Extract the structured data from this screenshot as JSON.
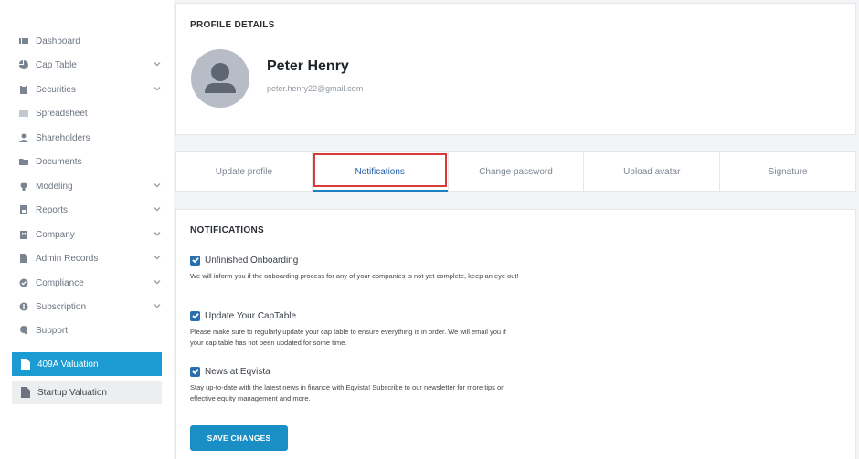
{
  "sidebar": {
    "items": [
      {
        "label": "Dashboard",
        "icon": "dashboard-icon",
        "chevron": false
      },
      {
        "label": "Cap Table",
        "icon": "pie-chart-icon",
        "chevron": true
      },
      {
        "label": "Securities",
        "icon": "clipboard-icon",
        "chevron": true
      },
      {
        "label": "Spreadsheet",
        "icon": "table-icon",
        "chevron": false
      },
      {
        "label": "Shareholders",
        "icon": "user-icon",
        "chevron": false
      },
      {
        "label": "Documents",
        "icon": "folder-icon",
        "chevron": false
      },
      {
        "label": "Modeling",
        "icon": "lightbulb-icon",
        "chevron": true
      },
      {
        "label": "Reports",
        "icon": "report-icon",
        "chevron": true
      },
      {
        "label": "Company",
        "icon": "building-icon",
        "chevron": true
      },
      {
        "label": "Admin Records",
        "icon": "file-icon",
        "chevron": true
      },
      {
        "label": "Compliance",
        "icon": "check-circle-icon",
        "chevron": true
      },
      {
        "label": "Subscription",
        "icon": "dollar-icon",
        "chevron": true
      },
      {
        "label": "Support",
        "icon": "support-icon",
        "chevron": false
      }
    ],
    "valuation_active": "409A Valuation",
    "valuation_inactive": "Startup Valuation"
  },
  "profile": {
    "section_title": "PROFILE DETAILS",
    "name": "Peter Henry",
    "email": "peter.henry22@gmail.com"
  },
  "tabs": [
    {
      "label": "Update profile",
      "active": false
    },
    {
      "label": "Notifications",
      "active": true
    },
    {
      "label": "Change password",
      "active": false
    },
    {
      "label": "Upload avatar",
      "active": false
    },
    {
      "label": "Signature",
      "active": false
    }
  ],
  "notifications": {
    "section_title": "NOTIFICATIONS",
    "items": [
      {
        "label": "Unfinished Onboarding",
        "checked": true,
        "description": "We will inform you if the onboarding process for any of your companies is not yet complete, keep an eye out!"
      },
      {
        "label": "Update Your CapTable",
        "checked": true,
        "description": "Please make sure to regularly update your cap table to ensure everything is in order. We will email you if your cap table has not been updated for some time."
      },
      {
        "label": "News at Eqvista",
        "checked": true,
        "description": "Stay up-to-date with the latest news in finance with Eqvista! Subscribe to our newsletter for more tips on effective equity management and more."
      }
    ],
    "save_label": "SAVE CHANGES"
  },
  "colors": {
    "accent": "#1b9bd1",
    "highlight_box": "#d83a3a",
    "checkbox": "#2a6fad"
  }
}
